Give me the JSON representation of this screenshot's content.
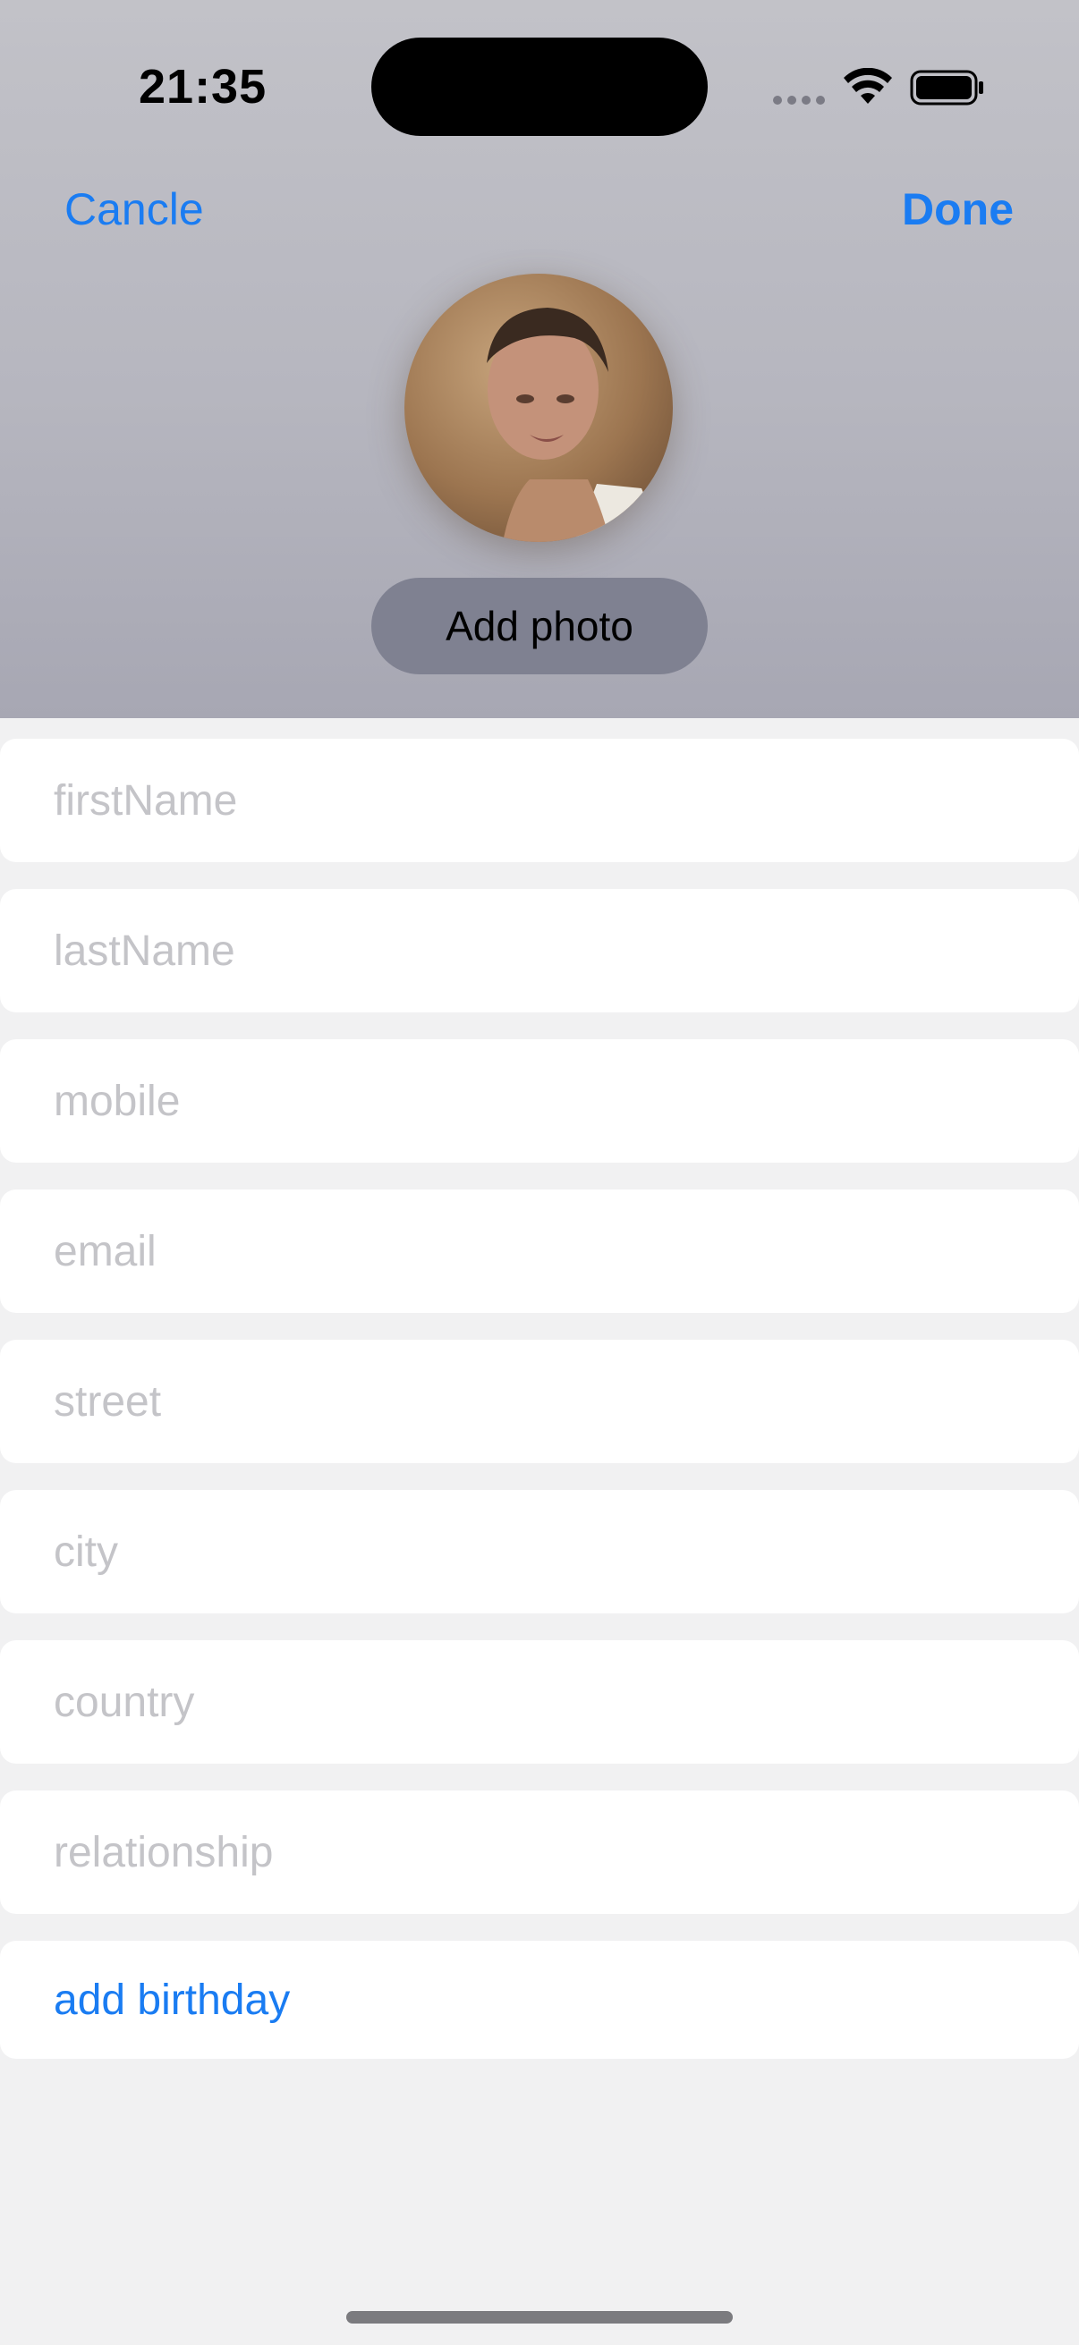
{
  "status_bar": {
    "time": "21:35"
  },
  "nav": {
    "cancel_label": "Cancle",
    "done_label": "Done"
  },
  "profile": {
    "add_photo_label": "Add photo"
  },
  "form": {
    "fields": [
      {
        "name": "firstName",
        "placeholder": "firstName",
        "value": ""
      },
      {
        "name": "lastName",
        "placeholder": "lastName",
        "value": ""
      },
      {
        "name": "mobile",
        "placeholder": "mobile",
        "value": ""
      },
      {
        "name": "email",
        "placeholder": "email",
        "value": ""
      },
      {
        "name": "street",
        "placeholder": "street",
        "value": ""
      },
      {
        "name": "city",
        "placeholder": "city",
        "value": ""
      },
      {
        "name": "country",
        "placeholder": "country",
        "value": ""
      },
      {
        "name": "relationship",
        "placeholder": "relationship",
        "value": ""
      }
    ],
    "add_birthday_label": "add birthday"
  },
  "colors": {
    "accent": "#1a7cf2",
    "header_top": "#c2c2c8",
    "header_bottom": "#a7a7b3",
    "add_photo_bg": "#7f8191",
    "page_bg": "#f1f1f2",
    "placeholder": "#c4c4c8"
  },
  "icons": [
    "cellular-signal-icon",
    "wifi-icon",
    "battery-icon"
  ]
}
